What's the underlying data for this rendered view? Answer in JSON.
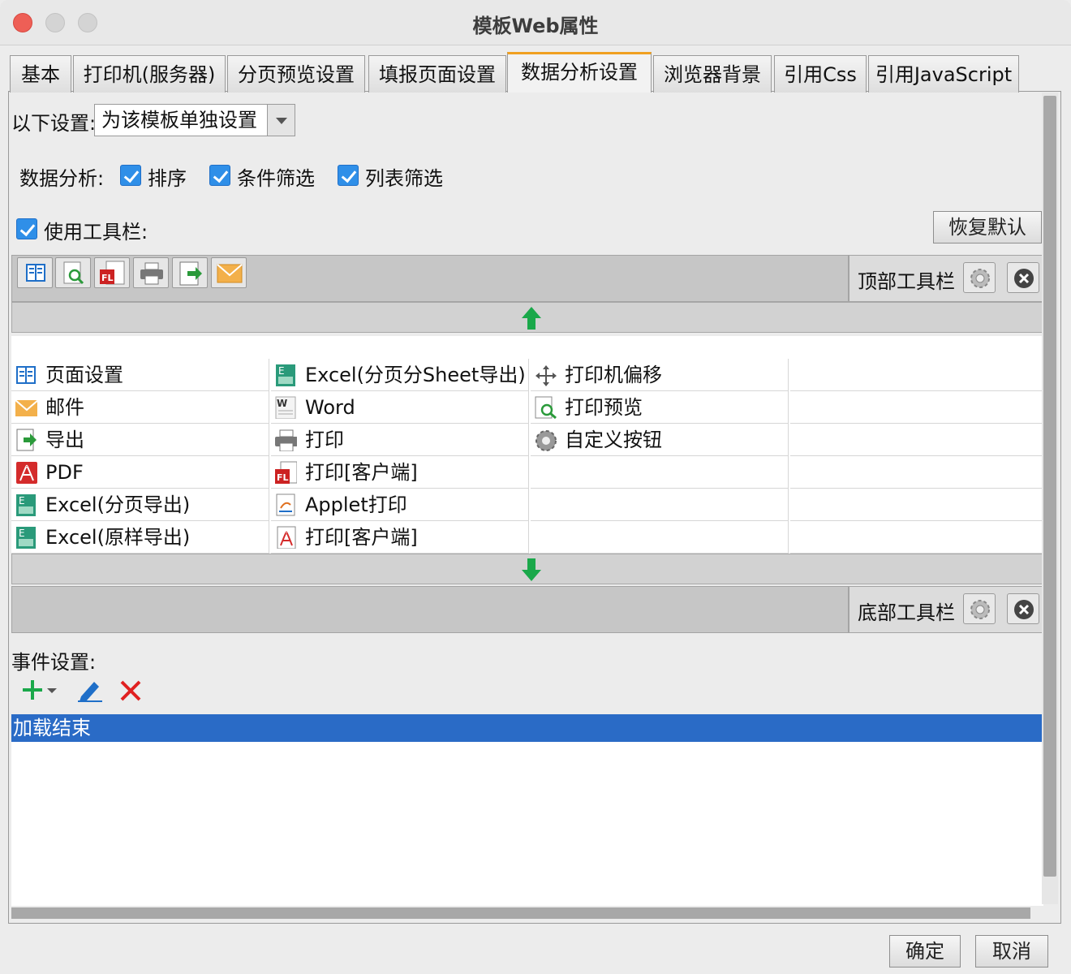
{
  "window": {
    "title": "模板Web属性"
  },
  "tabs": [
    {
      "label": "基本"
    },
    {
      "label": "打印机(服务器)"
    },
    {
      "label": "分页预览设置"
    },
    {
      "label": "填报页面设置"
    },
    {
      "label": "数据分析设置"
    },
    {
      "label": "浏览器背景"
    },
    {
      "label": "引用Css"
    },
    {
      "label": "引用JavaScript"
    }
  ],
  "active_tab": "数据分析设置",
  "settings": {
    "label": "以下设置:",
    "selected": "为该模板单独设置"
  },
  "analysis": {
    "label": "数据分析:",
    "options": [
      {
        "label": "排序",
        "checked": true
      },
      {
        "label": "条件筛选",
        "checked": true
      },
      {
        "label": "列表筛选",
        "checked": true
      }
    ]
  },
  "toolbar": {
    "use_label": "使用工具栏:",
    "use_checked": true,
    "restore_label": "恢复默认",
    "top_label": "顶部工具栏",
    "bottom_label": "底部工具栏"
  },
  "buttons": {
    "col1": [
      "页面设置",
      "邮件",
      "导出",
      "PDF",
      "Excel(分页导出)",
      "Excel(原样导出)"
    ],
    "col2": [
      "Excel(分页分Sheet导出)",
      "Word",
      "打印",
      "打印[客户端]",
      "Applet打印",
      "打印[客户端]"
    ],
    "col3": [
      "打印机偏移",
      "打印预览",
      "自定义按钮"
    ]
  },
  "events": {
    "label": "事件设置:",
    "items": [
      "加载结束"
    ]
  },
  "footer": {
    "ok": "确定",
    "cancel": "取消"
  },
  "colors": {
    "accent": "#2a6bc6",
    "tab_highlight": "#f0a020",
    "arrow_green": "#1aa84a"
  }
}
